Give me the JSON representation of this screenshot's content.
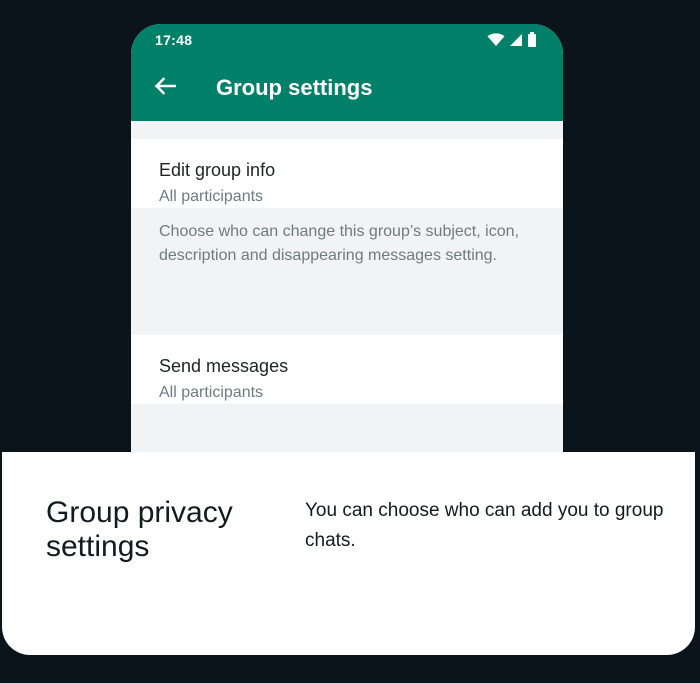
{
  "status_bar": {
    "time": "17:48"
  },
  "app_bar": {
    "title": "Group settings",
    "background_color": "#008069"
  },
  "settings": [
    {
      "label": "Edit group info",
      "value": "All participants"
    },
    {
      "label": "Send messages",
      "value": "All participants"
    }
  ],
  "edit_group_info_description": "Choose who can change this group’s subject, icon, description and disappearing messages setting.",
  "feature_card": {
    "title": "Group privacy settings",
    "text": "You can choose who can add you to group chats."
  },
  "icons": {
    "back": "arrow-left-icon",
    "wifi": "wifi-icon",
    "signal": "signal-icon",
    "battery": "battery-icon"
  }
}
